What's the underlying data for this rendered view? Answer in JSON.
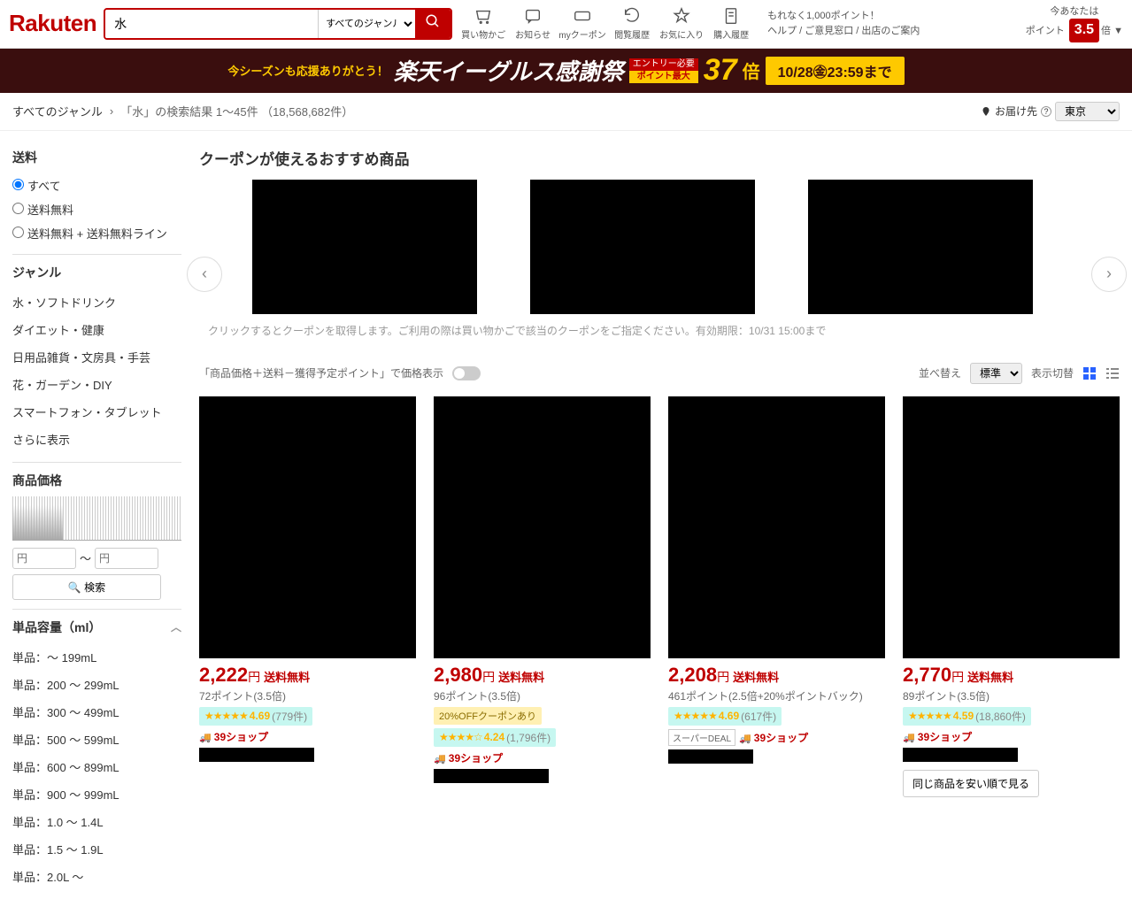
{
  "header": {
    "logo": "Rakuten",
    "search_value": "水",
    "genre_selector": "すべてのジャンル",
    "links": [
      "買い物かご",
      "お知らせ",
      "myクーポン",
      "閲覧履歴",
      "お気に入り",
      "購入履歴"
    ],
    "help_line1": "もれなく1,000ポイント！",
    "help_line2": "ヘルプ / ご意見窓口 / 出店のご案内",
    "pts_label1": "今あなたは",
    "pts_label2": "ポイント",
    "pts_value": "3.5",
    "pts_suffix": "倍 ▼"
  },
  "banner": {
    "pre": "今シーズンも応援ありがとう！",
    "main": "楽天イーグルス感謝祭",
    "entry": "エントリー必要",
    "pt_label": "ポイント最大",
    "mult": "37",
    "mult_suffix": "倍",
    "deadline": "10/28㊎23:59まで"
  },
  "breadcrumb": {
    "root": "すべてのジャンル",
    "sep": "›",
    "result": "「水」の検索結果 1〜45件 （18,568,682件）",
    "deliver_label": "お届け先",
    "deliver_region": "東京"
  },
  "sidebar": {
    "shipping_h": "送料",
    "ship_opts": [
      "すべて",
      "送料無料",
      "送料無料 + 送料無料ライン"
    ],
    "genre_h": "ジャンル",
    "genres": [
      "水・ソフトドリンク",
      "ダイエット・健康",
      "日用品雑貨・文房具・手芸",
      "花・ガーデン・DIY",
      "スマートフォン・タブレット",
      "さらに表示"
    ],
    "price_h": "商品価格",
    "price_ph": "円",
    "price_sep": "〜",
    "search_btn": "検索",
    "vol_h": "単品容量（ml）",
    "vols": [
      "単品：〜 199mL",
      "単品：200 〜 299mL",
      "単品：300 〜 499mL",
      "単品：500 〜 599mL",
      "単品：600 〜 899mL",
      "単品：900 〜 999mL",
      "単品：1.0 〜 1.4L",
      "単品：1.5 〜 1.9L",
      "単品：2.0L 〜"
    ]
  },
  "coupon": {
    "heading": "クーポンが使えるおすすめ商品",
    "note": "クリックするとクーポンを取得します。ご利用の際は買い物かごで該当のクーポンをご指定ください。有効期限：10/31 15:00まで"
  },
  "sort": {
    "toggle_label": "「商品価格＋送料－獲得予定ポイント」で価格表示",
    "sort_label": "並べ替え",
    "sort_value": "標準",
    "view_label": "表示切替"
  },
  "products": [
    {
      "price": "2,222",
      "ship": "送料無料",
      "pts": "72ポイント(3.5倍)",
      "rating": "4.69",
      "reviews": "(779件)",
      "shop": "39ショップ",
      "blk_w": 130
    },
    {
      "price": "2,980",
      "ship": "送料無料",
      "pts": "96ポイント(3.5倍)",
      "coupon": "20%OFFクーポンあり",
      "rating": "4.24",
      "reviews": "(1,796件)",
      "shop": "39ショップ",
      "blk_w": 130
    },
    {
      "price": "2,208",
      "ship": "送料無料",
      "pts": "461ポイント(2.5倍+20%ポイントバック)",
      "rating": "4.69",
      "reviews": "(617件)",
      "deal": "スーパーDEAL",
      "shop": "39ショップ",
      "blk_w": 96
    },
    {
      "price": "2,770",
      "ship": "送料無料",
      "pts": "89ポイント(3.5倍)",
      "rating": "4.59",
      "reviews": "(18,860件)",
      "shop": "39ショップ",
      "blk_w": 130,
      "compare": "同じ商品を安い順で見る"
    }
  ]
}
